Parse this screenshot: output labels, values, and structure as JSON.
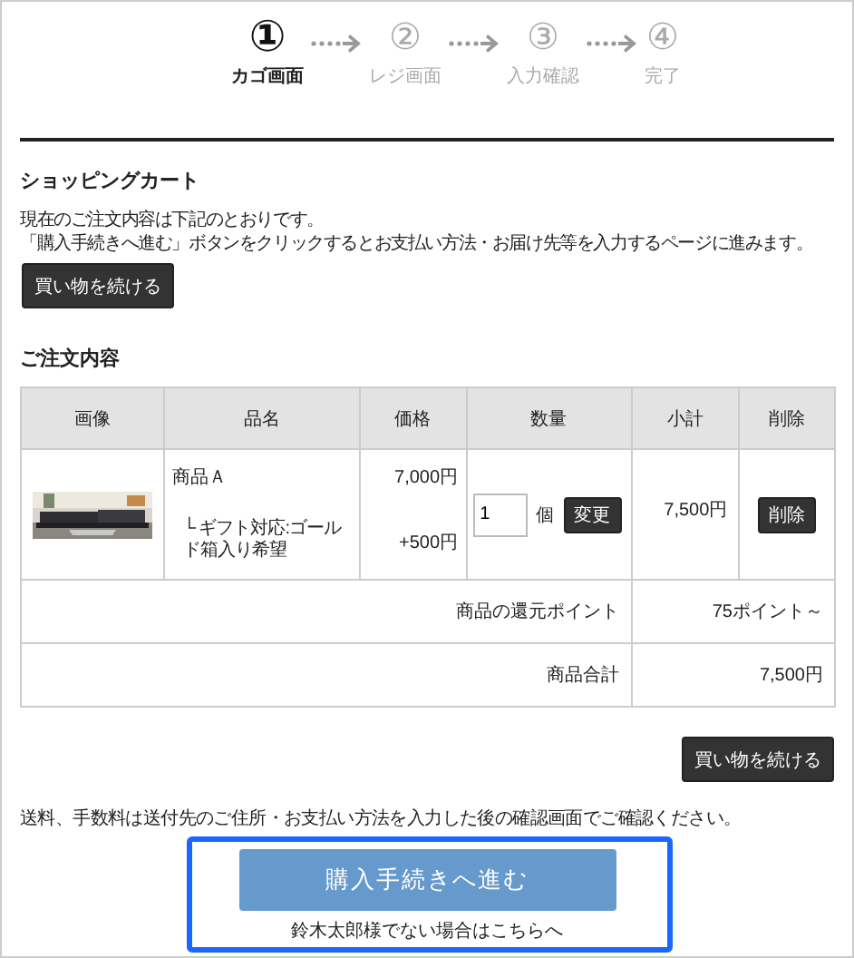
{
  "steps": [
    {
      "number": "①",
      "label": "カゴ画面",
      "selected": true
    },
    {
      "number": "②",
      "label": "レジ画面",
      "selected": false
    },
    {
      "number": "③",
      "label": "入力確認",
      "selected": false
    },
    {
      "number": "④",
      "label": "完了",
      "selected": false
    }
  ],
  "heading": "ショッピングカート",
  "intro": [
    "現在のご注文内容は下記のとおりです。",
    "「購入手続きへ進む」ボタンをクリックするとお支払い方法・お届け先等を入力するページに進みます。"
  ],
  "continue_button_top": "買い物を続ける",
  "order_heading": "ご注文内容",
  "table": {
    "columns": [
      "画像",
      "品名",
      "価格",
      "数量",
      "小計",
      "削除"
    ],
    "rows": [
      {
        "product": "商品Ａ",
        "option": "└ ギフト対応:ゴールド箱入り希望",
        "price": "7,000円",
        "option_price": "+500円",
        "quantity": "1",
        "unit": "個",
        "change_button": "変更",
        "subtotal": "7,500円",
        "delete_button": "削除"
      }
    ],
    "summary": [
      {
        "label": "商品の還元ポイント",
        "value": "75ポイント～"
      },
      {
        "label": "商品合計",
        "value": "7,500円"
      }
    ]
  },
  "continue_button_bottom": "買い物を続ける",
  "note": "送料、手数料は送付先のご住所・お支払い方法を入力した後の確認画面でご確認ください。",
  "checkout_button": "購入手続きへ進む",
  "other_user_link": "鈴木太郎様でない場合はこちらへ"
}
